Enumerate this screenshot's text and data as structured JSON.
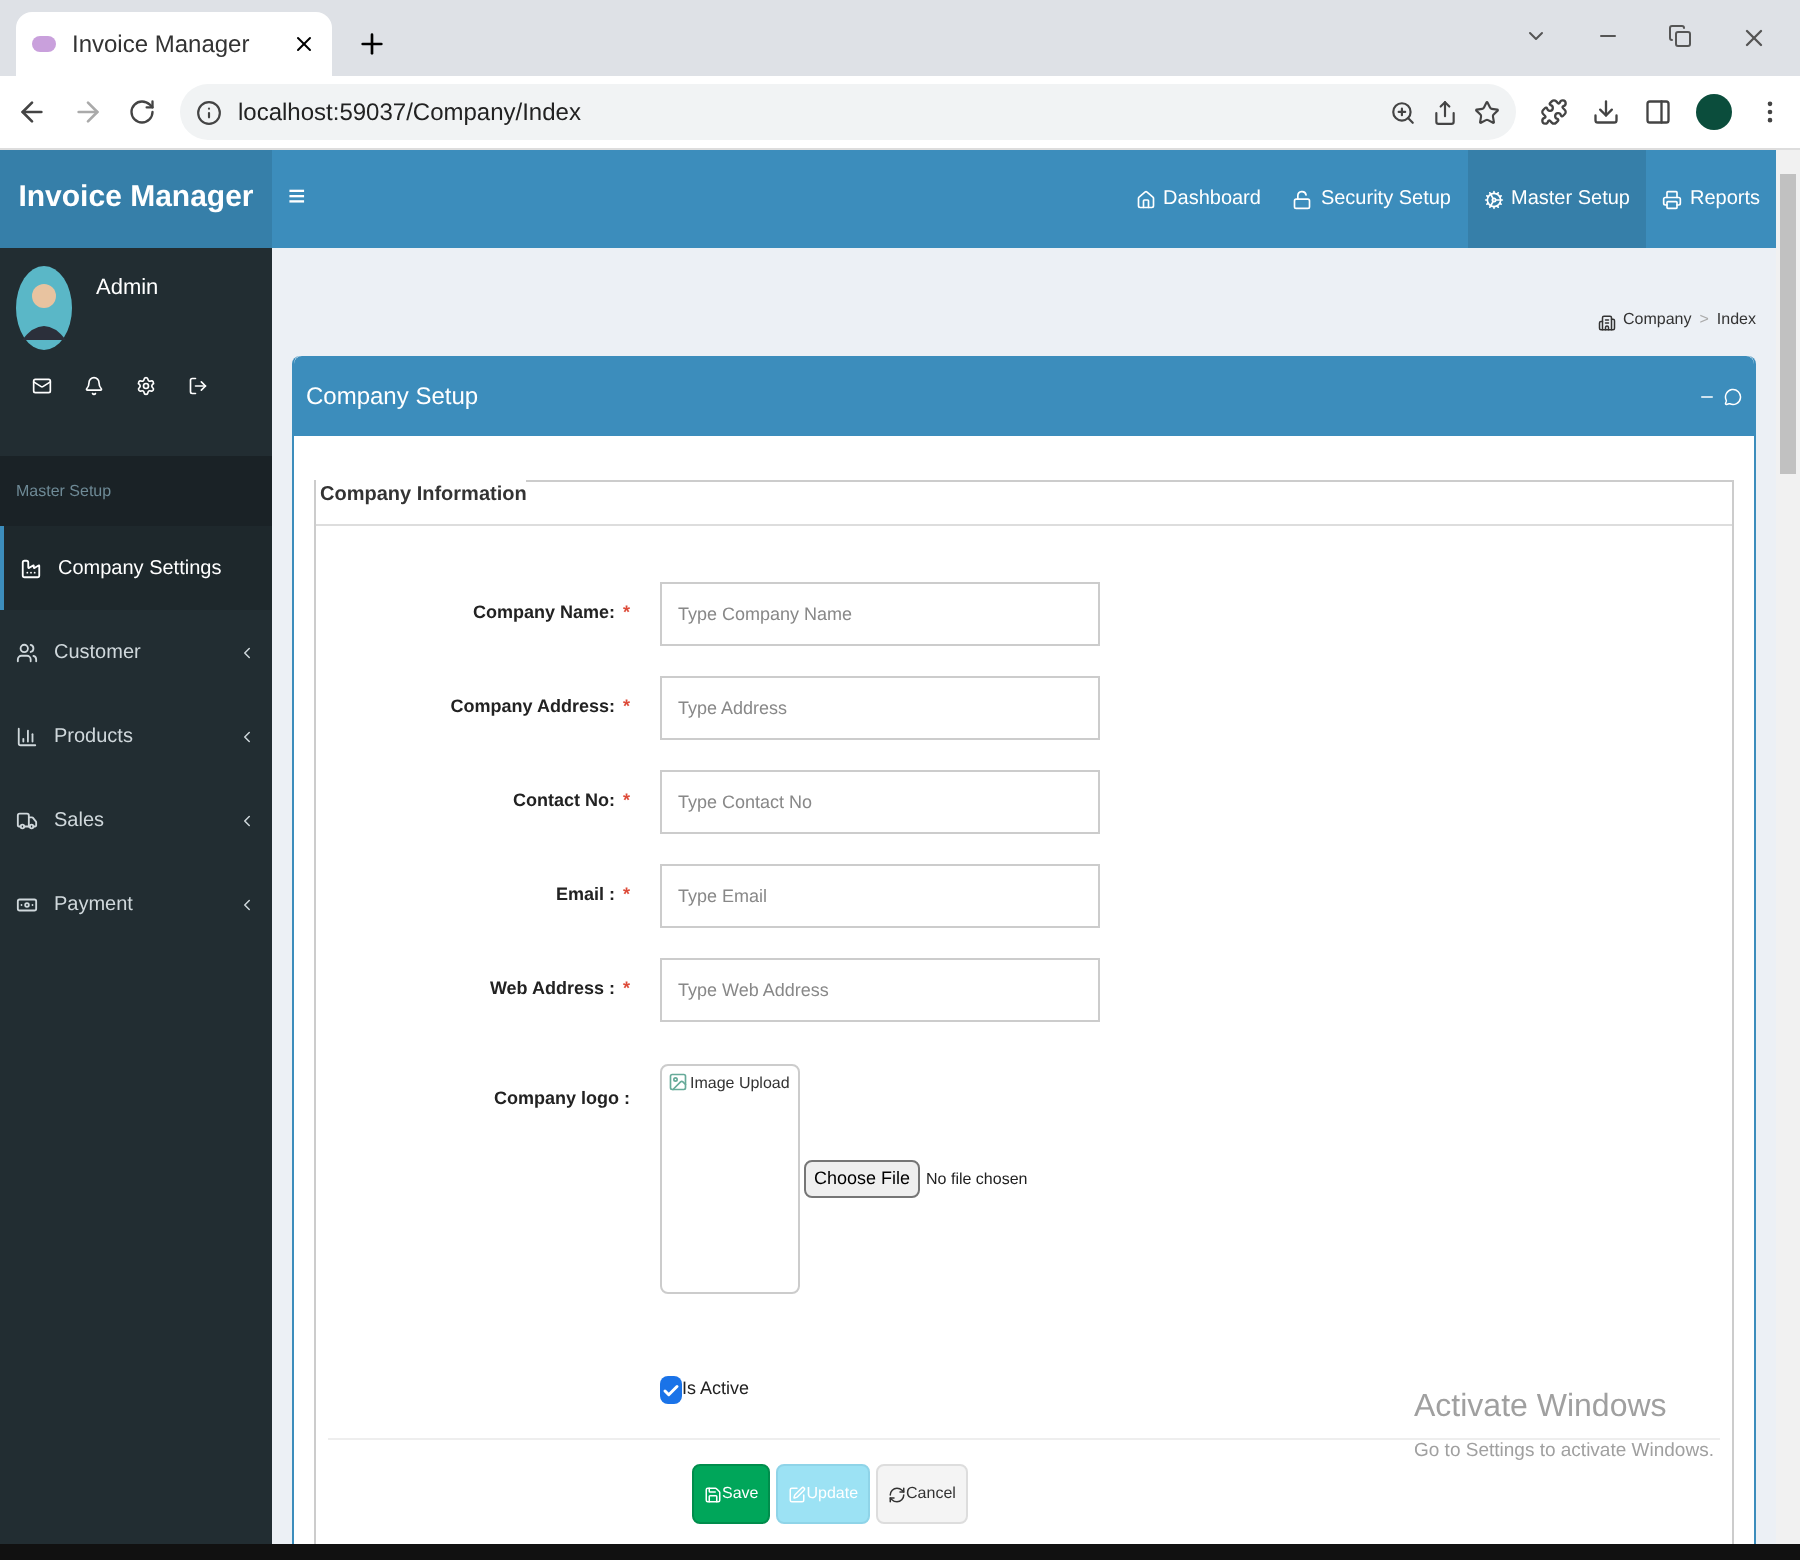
{
  "browser": {
    "tab_title": "Invoice Manager",
    "url": "localhost:59037/Company/Index"
  },
  "header": {
    "brand": "Invoice Manager",
    "menu_toggle": "≡",
    "nav": [
      {
        "label": "Dashboard",
        "selected": false
      },
      {
        "label": "Security Setup",
        "selected": false
      },
      {
        "label": "Master Setup",
        "selected": true
      },
      {
        "label": "Reports",
        "selected": false
      }
    ]
  },
  "sidebar": {
    "user": "Admin",
    "section": "Master Setup",
    "items": [
      {
        "label": "Company Settings",
        "selected": true,
        "has_children": false
      },
      {
        "label": "Customer",
        "selected": false,
        "has_children": true
      },
      {
        "label": "Products",
        "selected": false,
        "has_children": true
      },
      {
        "label": "Sales",
        "selected": false,
        "has_children": true
      },
      {
        "label": "Payment",
        "selected": false,
        "has_children": true
      }
    ]
  },
  "breadcrumb": {
    "items": [
      "Company",
      "Index"
    ],
    "separator": ">"
  },
  "panel": {
    "title": "Company Setup",
    "legend": "Company Information",
    "fields": [
      {
        "label": "Company Name:",
        "required_mark": "*",
        "placeholder": "Type Company Name"
      },
      {
        "label": "Company Address:",
        "required_mark": "*",
        "placeholder": "Type Address"
      },
      {
        "label": "Contact No:",
        "required_mark": "*",
        "placeholder": "Type Contact No"
      },
      {
        "label": "Email :",
        "required_mark": "*",
        "placeholder": "Type Email"
      },
      {
        "label": "Web Address :",
        "required_mark": "*",
        "placeholder": "Type Web Address"
      }
    ],
    "logo": {
      "label": "Company logo :",
      "image_alt": "Image Upload",
      "file_button": "Choose File",
      "file_status": "No file chosen"
    },
    "active": {
      "label": "Is Active",
      "checked": true
    },
    "buttons": [
      {
        "label": "Save",
        "kind": "save",
        "disabled": false
      },
      {
        "label": "Update",
        "kind": "update",
        "disabled": true
      },
      {
        "label": "Cancel",
        "kind": "cancel",
        "disabled": false
      }
    ]
  },
  "os_notice": {
    "title": "Activate Windows",
    "subtitle": "Go to Settings to activate Windows."
  }
}
